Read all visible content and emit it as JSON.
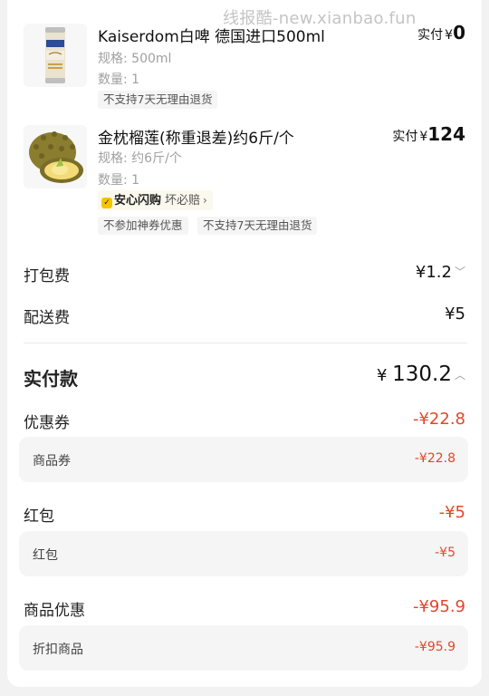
{
  "watermark": "线报酷-new.xianbao.fun",
  "products": [
    {
      "name": "Kaiserdom白啤 德国进口500ml",
      "spec": "规格: 500ml",
      "qty": "数量: 1",
      "price_label": "实付",
      "price_currency": "¥",
      "price_value": "0",
      "tags": [
        "不支持7天无理由退货"
      ],
      "image": "beer-can"
    },
    {
      "name": "金枕榴莲(称重退差)约6斤/个",
      "spec": "规格: 约6斤/个",
      "qty": "数量: 1",
      "price_label": "实付",
      "price_currency": "¥",
      "price_value": "124",
      "assurance": {
        "title": "安心闪购",
        "subtitle": "坏必赔"
      },
      "tags": [
        "不参加神券优惠",
        "不支持7天无理由退货"
      ],
      "image": "durian"
    }
  ],
  "fees": {
    "packing_label": "打包费",
    "packing_value": "¥1.2",
    "delivery_label": "配送费",
    "delivery_value": "¥5"
  },
  "total": {
    "label": "实付款",
    "currency": "¥",
    "value": "130.2"
  },
  "discounts": [
    {
      "label": "优惠券",
      "value": "-¥22.8",
      "detail_label": "商品券",
      "detail_value": "-¥22.8"
    },
    {
      "label": "红包",
      "value": "-¥5",
      "detail_label": "红包",
      "detail_value": "-¥5"
    },
    {
      "label": "商品优惠",
      "value": "-¥95.9",
      "detail_label": "折扣商品",
      "detail_value": "-¥95.9"
    }
  ],
  "colors": {
    "accent_red": "#e0482b",
    "assure_yellow": "#f6c400"
  }
}
